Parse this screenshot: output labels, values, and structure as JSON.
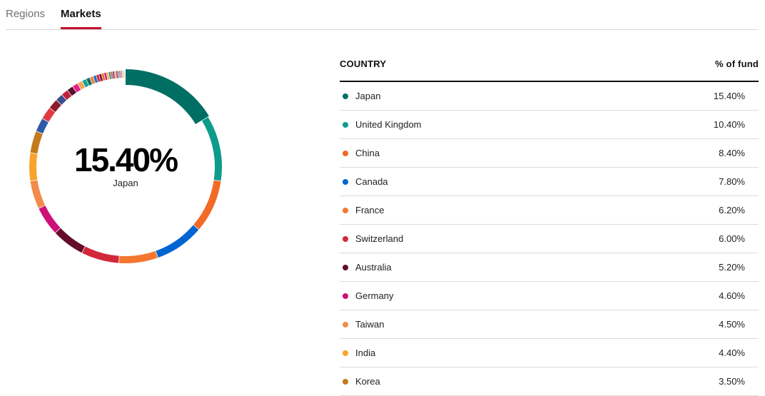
{
  "tabs": [
    {
      "label": "Regions",
      "active": false
    },
    {
      "label": "Markets",
      "active": true
    }
  ],
  "donut_center": {
    "value": "15.40%",
    "label": "Japan"
  },
  "table": {
    "header": {
      "country": "COUNTRY",
      "pct": "% of fund"
    },
    "rows": [
      {
        "country": "Japan",
        "value": "15.40%",
        "color": "#006e63"
      },
      {
        "country": "United Kingdom",
        "value": "10.40%",
        "color": "#0d9b8c"
      },
      {
        "country": "China",
        "value": "8.40%",
        "color": "#f26a26"
      },
      {
        "country": "Canada",
        "value": "7.80%",
        "color": "#0064d2"
      },
      {
        "country": "France",
        "value": "6.20%",
        "color": "#f5762f"
      },
      {
        "country": "Switzerland",
        "value": "6.00%",
        "color": "#d3273a"
      },
      {
        "country": "Australia",
        "value": "5.20%",
        "color": "#640c2a"
      },
      {
        "country": "Germany",
        "value": "4.60%",
        "color": "#cf0f78"
      },
      {
        "country": "Taiwan",
        "value": "4.50%",
        "color": "#f38b4a"
      },
      {
        "country": "India",
        "value": "4.40%",
        "color": "#f8a32e"
      },
      {
        "country": "Korea",
        "value": "3.50%",
        "color": "#c47a1c"
      }
    ]
  },
  "chart_data": {
    "type": "pie",
    "categories": [
      "Japan",
      "United Kingdom",
      "China",
      "Canada",
      "France",
      "Switzerland",
      "Australia",
      "Germany",
      "Taiwan",
      "India",
      "Korea"
    ],
    "values": [
      15.4,
      10.4,
      8.4,
      7.8,
      6.2,
      6.0,
      5.2,
      4.6,
      4.5,
      4.4,
      3.5
    ],
    "unit": "%",
    "highlighted": "Japan",
    "remaining_slices": [
      {
        "value": 2.2,
        "color": "#2f5aa8"
      },
      {
        "value": 2.0,
        "color": "#e03a3e"
      },
      {
        "value": 1.6,
        "color": "#8b1c2e"
      },
      {
        "value": 1.2,
        "color": "#3c4e8e"
      },
      {
        "value": 1.1,
        "color": "#c0213b"
      },
      {
        "value": 1.0,
        "color": "#5a1030"
      },
      {
        "value": 0.9,
        "color": "#e3208a"
      },
      {
        "value": 0.8,
        "color": "#f5a35e"
      },
      {
        "value": 0.7,
        "color": "#1aa38f"
      },
      {
        "value": 0.6,
        "color": "#0b6f68"
      },
      {
        "value": 0.55,
        "color": "#f28032"
      },
      {
        "value": 0.5,
        "color": "#1f6fd6"
      },
      {
        "value": 0.45,
        "color": "#d4283d"
      },
      {
        "value": 0.42,
        "color": "#7a1430"
      },
      {
        "value": 0.4,
        "color": "#f06a2a"
      },
      {
        "value": 0.38,
        "color": "#cc1e7a"
      },
      {
        "value": 0.35,
        "color": "#f7b24a"
      },
      {
        "value": 0.33,
        "color": "#2a8f86"
      },
      {
        "value": 0.3,
        "color": "#e8453c"
      },
      {
        "value": 0.28,
        "color": "#5e2b8c"
      },
      {
        "value": 0.26,
        "color": "#f39a3d"
      },
      {
        "value": 0.24,
        "color": "#9b1b3a"
      },
      {
        "value": 0.22,
        "color": "#2b6bbd"
      },
      {
        "value": 0.2,
        "color": "#d6622c"
      },
      {
        "value": 0.18,
        "color": "#b6215e"
      },
      {
        "value": 0.16,
        "color": "#7d8a3a"
      },
      {
        "value": 0.14,
        "color": "#c5872e"
      },
      {
        "value": 0.12,
        "color": "#9e9e9e"
      },
      {
        "value": 0.11,
        "color": "#4b4b8f"
      },
      {
        "value": 0.1,
        "color": "#bbbbbb"
      }
    ]
  }
}
